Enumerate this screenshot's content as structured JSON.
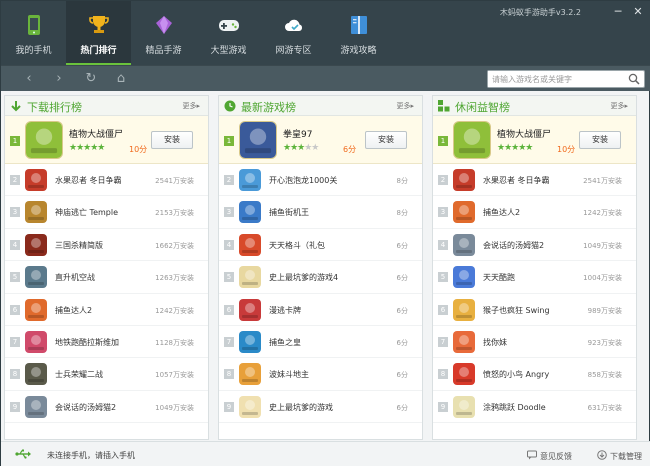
{
  "window": {
    "title": "木蚂蚁手游助手v3.2.2",
    "minimize": "─",
    "close": "✕"
  },
  "nav": [
    {
      "label": "我的手机",
      "icon": "phone-icon"
    },
    {
      "label": "热门排行",
      "icon": "trophy-icon",
      "active": true
    },
    {
      "label": "精品手游",
      "icon": "diamond-icon"
    },
    {
      "label": "大型游戏",
      "icon": "gamepad-icon"
    },
    {
      "label": "网游专区",
      "icon": "cloud-icon"
    },
    {
      "label": "游戏攻略",
      "icon": "book-icon"
    }
  ],
  "toolbar": {
    "back": "‹",
    "forward": "›",
    "refresh": "↻",
    "home": "⌂",
    "search_placeholder": "请输入游戏名或关键字"
  },
  "panels": [
    {
      "title": "下载排行榜",
      "icon": "download-arrow-icon",
      "more": "更多▸",
      "featured": {
        "rank": "1",
        "name": "植物大战僵尸",
        "stars": 5,
        "score": "10分",
        "install": "安装",
        "icon_color": "#8fbf3a"
      },
      "rows": [
        {
          "rank": "2",
          "name": "水果忍者 冬日争霸",
          "count": "2541万安装",
          "color": "#c63c2a"
        },
        {
          "rank": "3",
          "name": "神庙逃亡 Temple",
          "count": "2153万安装",
          "color": "#b8862e"
        },
        {
          "rank": "4",
          "name": "三国杀精简版",
          "count": "1662万安装",
          "color": "#8a2a1c"
        },
        {
          "rank": "5",
          "name": "直升机空战",
          "count": "1263万安装",
          "color": "#5b7a8c"
        },
        {
          "rank": "6",
          "name": "捕鱼达人2",
          "count": "1242万安装",
          "color": "#e06a2c"
        },
        {
          "rank": "7",
          "name": "地铁跑酷拉斯维加",
          "count": "1128万安装",
          "color": "#d04a6a"
        },
        {
          "rank": "8",
          "name": "士兵荣耀二战",
          "count": "1057万安装",
          "color": "#5a5a4a"
        },
        {
          "rank": "9",
          "name": "会说话的汤姆猫2",
          "count": "1049万安装",
          "color": "#7a8a9a"
        }
      ]
    },
    {
      "title": "最新游戏榜",
      "icon": "clock-icon",
      "more": "更多▸",
      "featured": {
        "rank": "1",
        "name": "拳皇97",
        "stars": 3,
        "score": "6分",
        "install": "安装",
        "icon_color": "#3a5a9a"
      },
      "rows": [
        {
          "rank": "2",
          "name": "开心泡泡龙1000关",
          "count": "8分",
          "color": "#4a9ad8"
        },
        {
          "rank": "3",
          "name": "捕鱼街机王",
          "count": "8分",
          "color": "#3a7ac8"
        },
        {
          "rank": "4",
          "name": "天天格斗（礼包",
          "count": "6分",
          "color": "#d84a2a"
        },
        {
          "rank": "5",
          "name": "史上最坑爹的游戏4",
          "count": "6分",
          "color": "#e8d8a0"
        },
        {
          "rank": "6",
          "name": "漫逃卡牌",
          "count": "6分",
          "color": "#c83a3a"
        },
        {
          "rank": "7",
          "name": "捕鱼之皇",
          "count": "6分",
          "color": "#2a8ac8"
        },
        {
          "rank": "8",
          "name": "波妹斗地主",
          "count": "6分",
          "color": "#e8a03a"
        },
        {
          "rank": "9",
          "name": "史上最坑爹的游戏",
          "count": "6分",
          "color": "#f0e0b0"
        }
      ]
    },
    {
      "title": "休闲益智榜",
      "icon": "blocks-icon",
      "more": "更多▸",
      "featured": {
        "rank": "1",
        "name": "植物大战僵尸",
        "stars": 5,
        "score": "10分",
        "install": "安装",
        "icon_color": "#8fbf3a"
      },
      "rows": [
        {
          "rank": "2",
          "name": "水果忍者 冬日争霸",
          "count": "2541万安装",
          "color": "#c63c2a"
        },
        {
          "rank": "3",
          "name": "捕鱼达人2",
          "count": "1242万安装",
          "color": "#e06a2c"
        },
        {
          "rank": "4",
          "name": "会说话的汤姆猫2",
          "count": "1049万安装",
          "color": "#7a8a9a"
        },
        {
          "rank": "5",
          "name": "天天酷跑",
          "count": "1004万安装",
          "color": "#4a7ad8"
        },
        {
          "rank": "6",
          "name": "猴子也疯狂 Swing",
          "count": "989万安装",
          "color": "#e8b040"
        },
        {
          "rank": "7",
          "name": "找你妹",
          "count": "923万安装",
          "color": "#e86a3a"
        },
        {
          "rank": "8",
          "name": "愤怒的小鸟 Angry",
          "count": "858万安装",
          "color": "#d83a2a"
        },
        {
          "rank": "9",
          "name": "涂鸦跳跃 Doodle",
          "count": "631万安装",
          "color": "#e8e0b0"
        }
      ]
    }
  ],
  "status": {
    "connection": "未连接手机，请插入手机",
    "feedback": "意见反馈",
    "download_manager": "下载管理"
  },
  "colors": {
    "accent": "#4fa632",
    "header_bg": "#35444b",
    "toolbar_bg": "#4a5a61",
    "star": "#5bb33a",
    "score": "#f06a1d"
  }
}
